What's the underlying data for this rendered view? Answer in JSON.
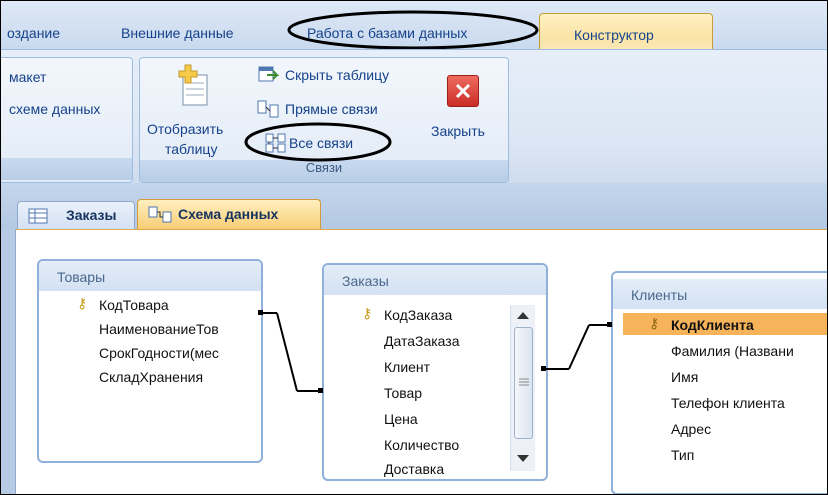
{
  "ribbon": {
    "tabs": [
      {
        "label": "оздание"
      },
      {
        "label": "Внешние данные"
      },
      {
        "label": "Работа с базами данных"
      },
      {
        "label": "Конструктор"
      }
    ],
    "left_group": {
      "line1": "макет",
      "line2": "схеме данных"
    },
    "relations_group": {
      "label": "Связи",
      "show_table": {
        "line1": "Отобразить",
        "line2": "таблицу"
      },
      "hide_table": "Скрыть таблицу",
      "direct_links": "Прямые связи",
      "all_links": "Все связи",
      "close": "Закрыть"
    }
  },
  "doc_tabs": [
    {
      "label": "Заказы"
    },
    {
      "label": "Схема данных",
      "active": true
    }
  ],
  "tables": {
    "tovary": {
      "title": "Товары",
      "fields": [
        "КодТовара",
        "НаименованиеТов",
        "СрокГодности(мес",
        "СкладХранения"
      ]
    },
    "zakazy": {
      "title": "Заказы",
      "fields": [
        "КодЗаказа",
        "ДатаЗаказа",
        "Клиент",
        "Товар",
        "Цена",
        "Количество",
        "Доставка"
      ]
    },
    "klienty": {
      "title": "Клиенты",
      "fields": [
        "КодКлиента",
        "Фамилия (Названи",
        "Имя",
        "Телефон клиента",
        "Адрес",
        "Тип"
      ]
    }
  },
  "colors": {
    "accent_tab": "#fbe4a6",
    "ribbon_text": "#15428b",
    "selected_field": "#f6b35a",
    "close_button": "#d9403a"
  }
}
